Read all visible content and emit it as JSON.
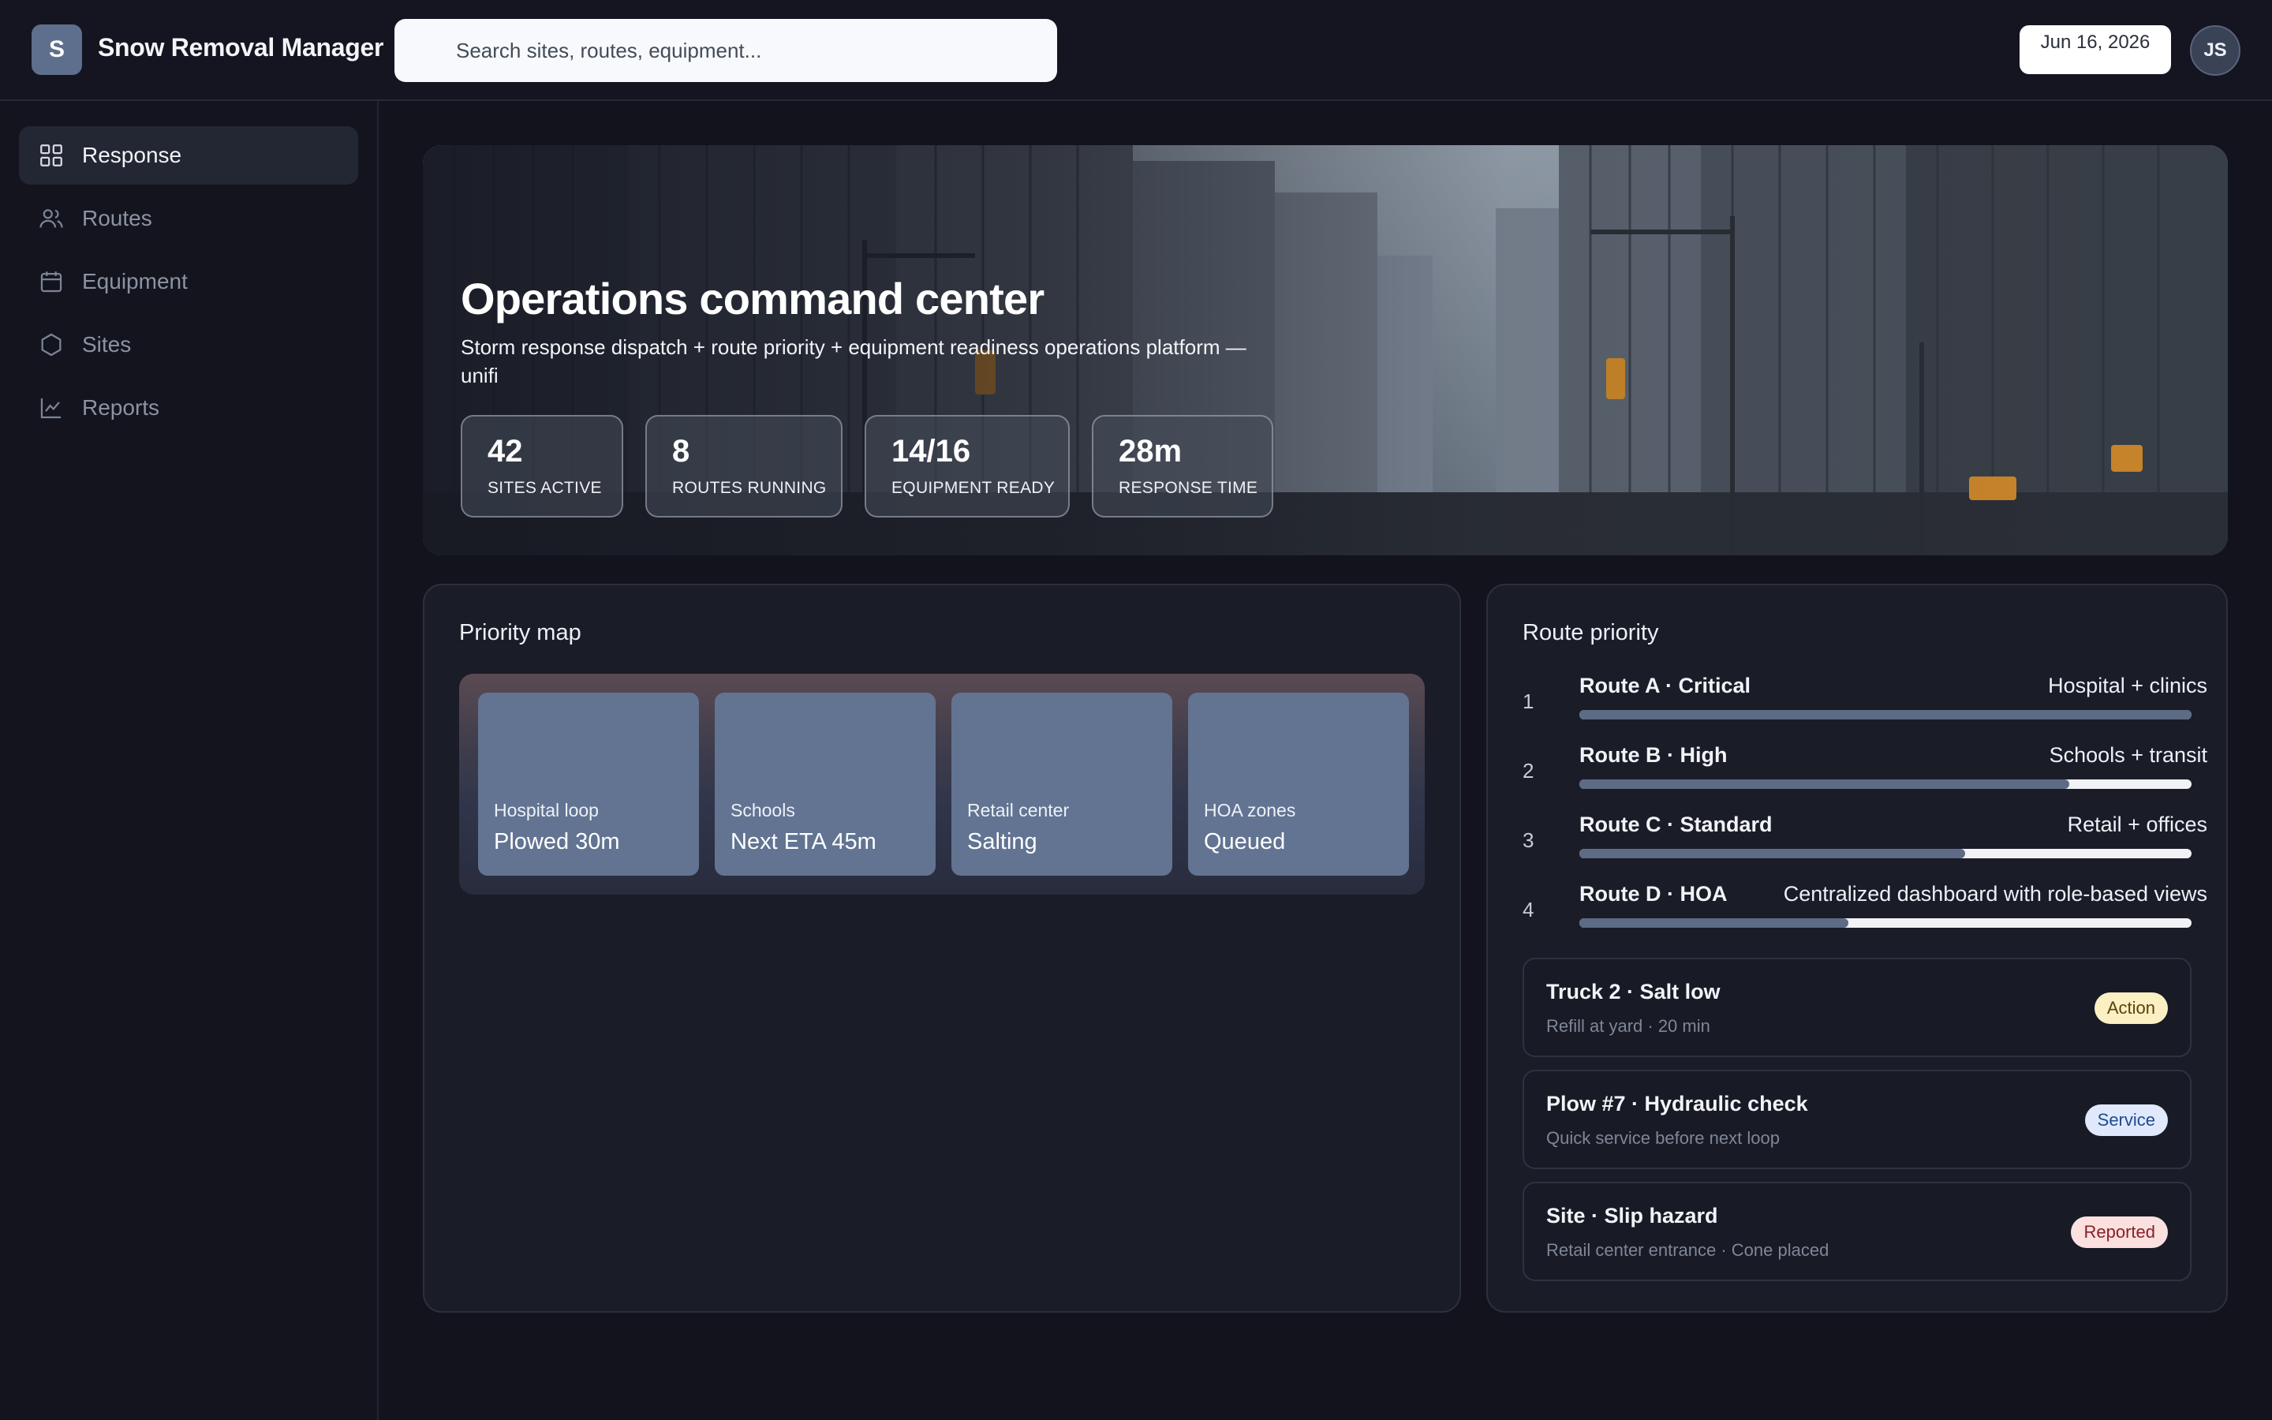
{
  "app": {
    "logo_letter": "S",
    "title": "Snow Removal Manager"
  },
  "search": {
    "placeholder": "Search sites, routes, equipment..."
  },
  "header": {
    "date": "Jun 16, 2026",
    "user_initials": "JS"
  },
  "sidebar": {
    "items": [
      {
        "label": "Response",
        "icon": "grid-icon",
        "active": true
      },
      {
        "label": "Routes",
        "icon": "users-icon",
        "active": false
      },
      {
        "label": "Equipment",
        "icon": "calendar-icon",
        "active": false
      },
      {
        "label": "Sites",
        "icon": "hexagon-icon",
        "active": false
      },
      {
        "label": "Reports",
        "icon": "line-chart-icon",
        "active": false
      }
    ]
  },
  "hero": {
    "title": "Operations command center",
    "subtitle": "Storm response dispatch + route priority + equipment readiness operations platform — unifi",
    "stats": [
      {
        "value": "42",
        "label": "SITES ACTIVE"
      },
      {
        "value": "8",
        "label": "ROUTES RUNNING"
      },
      {
        "value": "14/16",
        "label": "EQUIPMENT READY"
      },
      {
        "value": "28m",
        "label": "RESPONSE TIME"
      }
    ]
  },
  "priority_map": {
    "title": "Priority map",
    "tiles": [
      {
        "label": "Hospital loop",
        "value": "Plowed 30m"
      },
      {
        "label": "Schools",
        "value": "Next ETA 45m"
      },
      {
        "label": "Retail center",
        "value": "Salting"
      },
      {
        "label": "HOA zones",
        "value": "Queued"
      }
    ]
  },
  "route_priority": {
    "title": "Route priority",
    "routes": [
      {
        "num": "1",
        "name": "Route A · Critical",
        "desc": "Hospital + clinics",
        "progress": 1.0
      },
      {
        "num": "2",
        "name": "Route B · High",
        "desc": "Schools + transit",
        "progress": 0.8
      },
      {
        "num": "3",
        "name": "Route C · Standard",
        "desc": "Retail + offices",
        "progress": 0.63
      },
      {
        "num": "4",
        "name": "Route D · HOA",
        "desc": "Centralized dashboard with role-based views",
        "progress": 0.44
      }
    ],
    "alerts": [
      {
        "title": "Truck 2 · Salt low",
        "sub": "Refill at yard · 20 min",
        "tag": "Action",
        "tag_color": "#fbf0c4"
      },
      {
        "title": "Plow #7 · Hydraulic check",
        "sub": "Quick service before next loop",
        "tag": "Service",
        "tag_color": "#dfe9fb"
      },
      {
        "title": "Site · Slip hazard",
        "sub": "Retail center entrance · Cone placed",
        "tag": "Reported",
        "tag_color": "#fbe0e0"
      }
    ]
  },
  "colors": {
    "background": "#12131c",
    "card": "#1a1c28",
    "accent": "#5d6f8c",
    "bar_fill": "#5d6b85"
  }
}
